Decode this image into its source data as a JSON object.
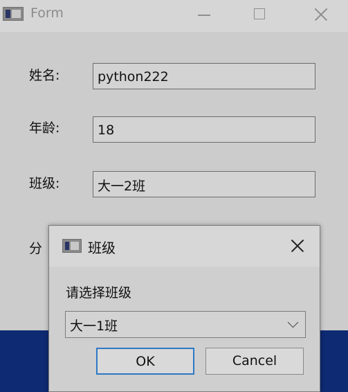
{
  "window": {
    "title": "Form"
  },
  "form": {
    "name_label": "姓名:",
    "name_value": "python222",
    "age_label": "年龄:",
    "age_value": "18",
    "class_label": "班级:",
    "class_value": "大一2班",
    "partial_label": "分"
  },
  "dialog": {
    "title": "班级",
    "prompt": "请选择班级",
    "selected_class": "大一1班",
    "ok_label": "OK",
    "cancel_label": "Cancel"
  },
  "colors": {
    "accent": "#2e78c5",
    "bottom_strip": "#0e2a72",
    "background": "#cccccc"
  }
}
